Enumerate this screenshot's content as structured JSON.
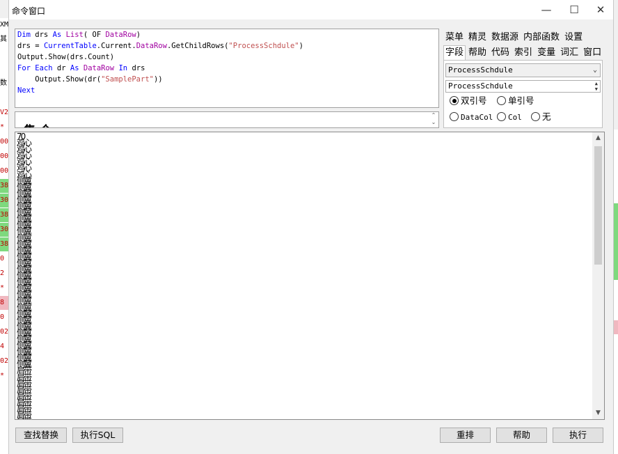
{
  "window": {
    "title": "命令窗口"
  },
  "title_buttons": {
    "minimize": "—",
    "maximize": "☐",
    "close": "✕"
  },
  "background_strip": [
    "XM",
    "其",
    "",
    "",
    "数",
    "",
    "V2",
    "*",
    "00",
    "00",
    "00",
    "38",
    "30",
    "38",
    "30",
    "38",
    "0",
    "2",
    "*",
    "8",
    "0",
    "02",
    "4",
    "02",
    "*"
  ],
  "editor": {
    "lines": [
      [
        {
          "t": "Dim",
          "c": "kw"
        },
        {
          "t": " drs ",
          "c": ""
        },
        {
          "t": "As",
          "c": "kw"
        },
        {
          "t": " ",
          "c": ""
        },
        {
          "t": "List",
          "c": "ty"
        },
        {
          "t": "( OF ",
          "c": ""
        },
        {
          "t": "DataRow",
          "c": "ty"
        },
        {
          "t": ")",
          "c": ""
        }
      ],
      [
        {
          "t": "drs = ",
          "c": ""
        },
        {
          "t": "CurrentTable",
          "c": "ob"
        },
        {
          "t": ".Current.",
          "c": ""
        },
        {
          "t": "DataRow",
          "c": "ty"
        },
        {
          "t": ".GetChildRows(",
          "c": ""
        },
        {
          "t": "\"ProcessSchdule\"",
          "c": "str"
        },
        {
          "t": ")",
          "c": ""
        }
      ],
      [
        {
          "t": "Output.Show(drs.Count)",
          "c": ""
        }
      ],
      [
        {
          "t": "For",
          "c": "kw"
        },
        {
          "t": " ",
          "c": ""
        },
        {
          "t": "Each",
          "c": "kw"
        },
        {
          "t": " dr ",
          "c": ""
        },
        {
          "t": "As",
          "c": "kw"
        },
        {
          "t": " ",
          "c": ""
        },
        {
          "t": "DataRow",
          "c": "ty"
        },
        {
          "t": " ",
          "c": ""
        },
        {
          "t": "In",
          "c": "kw"
        },
        {
          "t": " drs",
          "c": ""
        }
      ],
      [
        {
          "t": "    Output.Show(dr(",
          "c": ""
        },
        {
          "t": "\"SamplePart\"",
          "c": "str"
        },
        {
          "t": "))",
          "c": ""
        }
      ],
      [
        {
          "t": "Next",
          "c": "kw"
        }
      ]
    ]
  },
  "helper_text": "集合",
  "output": {
    "first": "70",
    "lines": [
      "鸡心",
      "鸡心",
      "鸡心",
      "鸡心",
      "鸡心",
      "鸡心",
      "侧翼",
      "侧翼",
      "侧翼",
      "侧翼",
      "侧翼",
      "侧翼",
      "侧翼",
      "侧翼",
      "侧翼",
      "侧翼",
      "侧翼",
      "侧翼",
      "侧翼",
      "侧翼",
      "侧翼",
      "侧翼",
      "侧翼",
      "侧翼",
      "侧翼",
      "侧翼",
      "侧翼",
      "侧翼",
      "侧翼",
      "侧翼",
      "侧翼",
      "侧翼",
      "侧翼",
      "侧翼",
      "侧翼",
      "侧翼",
      "肩带",
      "肩带",
      "肩带",
      "肩带",
      "肩带",
      "肩带",
      "肩带",
      "肩带",
      "肩带"
    ]
  },
  "tabs_row1": [
    "菜单",
    "精灵",
    "数据源",
    "内部函数",
    "设置"
  ],
  "tabs_row2": [
    "字段",
    "帮助",
    "代码",
    "索引",
    "变量",
    "词汇",
    "窗口"
  ],
  "active_tab": "字段",
  "table_select": "ProcessSchdule",
  "field_input": "ProcessSchdule",
  "radios": {
    "double_quote": "双引号",
    "single_quote": "单引号",
    "datacol": "DataCol",
    "col": "Col",
    "none": "无",
    "selected": "double_quote"
  },
  "buttons": {
    "find_replace": "查找替换",
    "exec_sql": "执行SQL",
    "rearrange": "重排",
    "help": "帮助",
    "execute": "执行"
  }
}
